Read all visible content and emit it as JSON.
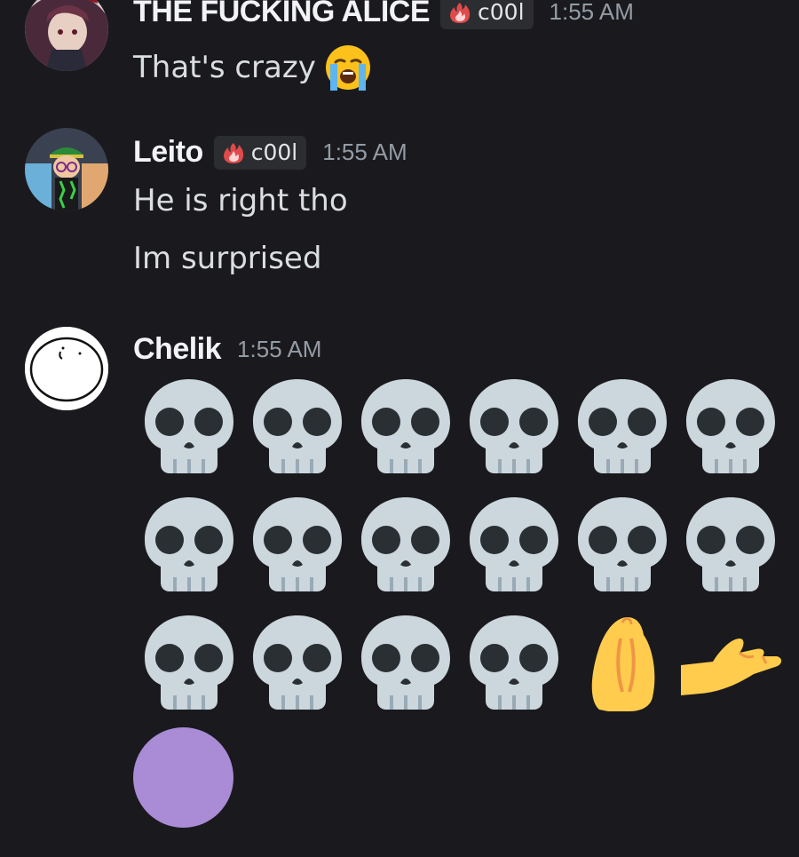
{
  "messages": [
    {
      "username": "THE FUCKING ALICE",
      "tag": "c00l",
      "time": "1:55 AM",
      "lines": [
        "That's crazy"
      ],
      "trailing_emoji": "loudly-crying-face"
    },
    {
      "username": "Leito",
      "tag": "c00l",
      "time": "1:55 AM",
      "lines": [
        "He is right tho",
        "Im surprised"
      ]
    },
    {
      "username": "Chelik",
      "time": "1:55 AM",
      "emoji_rows": [
        [
          "skull",
          "skull",
          "skull",
          "skull",
          "skull",
          "skull"
        ],
        [
          "skull",
          "skull",
          "skull",
          "skull",
          "skull",
          "skull"
        ],
        [
          "skull",
          "skull",
          "skull",
          "skull",
          "pinched-fingers",
          "palm-up-hand"
        ]
      ]
    }
  ],
  "colors": {
    "background": "#1a1a1e",
    "username": "#f2f3f5",
    "timestamp": "#949ba4",
    "tag_bg": "#2b2d31",
    "skull": "#ccd6dd",
    "purple_circle": "#a98bd6"
  }
}
